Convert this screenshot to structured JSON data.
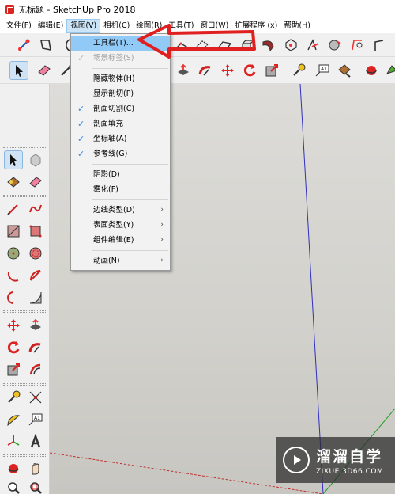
{
  "window": {
    "title": "无标题 - SketchUp Pro 2018"
  },
  "menubar": {
    "items": [
      "文件(F)",
      "编辑(E)",
      "视图(V)",
      "相机(C)",
      "绘图(R)",
      "工具(T)",
      "窗口(W)",
      "扩展程序 (x)",
      "帮助(H)"
    ],
    "active_index": 2
  },
  "view_menu": {
    "items": [
      {
        "label": "工具栏(T)...",
        "checked": false,
        "disabled": false,
        "submenu": false,
        "hover": true
      },
      {
        "label": "场景标签(S)",
        "checked": true,
        "disabled": true,
        "submenu": false
      },
      {
        "sep": true
      },
      {
        "label": "隐藏物体(H)",
        "checked": false,
        "disabled": false,
        "submenu": false
      },
      {
        "label": "显示剖切(P)",
        "checked": false,
        "disabled": false,
        "submenu": false
      },
      {
        "label": "剖面切割(C)",
        "checked": true,
        "disabled": false,
        "submenu": false
      },
      {
        "label": "剖面填充",
        "checked": true,
        "disabled": false,
        "submenu": false
      },
      {
        "label": "坐标轴(A)",
        "checked": true,
        "disabled": false,
        "submenu": false
      },
      {
        "label": "参考线(G)",
        "checked": true,
        "disabled": false,
        "submenu": false
      },
      {
        "sep": true
      },
      {
        "label": "阴影(D)",
        "checked": false,
        "disabled": false,
        "submenu": false
      },
      {
        "label": "雾化(F)",
        "checked": false,
        "disabled": false,
        "submenu": false
      },
      {
        "sep": true
      },
      {
        "label": "边线类型(D)",
        "checked": false,
        "disabled": false,
        "submenu": true
      },
      {
        "label": "表面类型(Y)",
        "checked": false,
        "disabled": false,
        "submenu": true
      },
      {
        "label": "组件编辑(E)",
        "checked": false,
        "disabled": false,
        "submenu": true
      },
      {
        "sep": true
      },
      {
        "label": "动画(N)",
        "checked": false,
        "disabled": false,
        "submenu": true
      }
    ],
    "check_glyph": "✓",
    "submenu_glyph": "›"
  },
  "watermark": {
    "cn": "溜溜自学",
    "url": "ZIXUE.3D66.COM"
  },
  "colors": {
    "accent": "#3c8ee0",
    "annotation_red": "#e02020",
    "axis_blue": "#3030c0",
    "axis_green": "#20a020",
    "axis_red": "#c03030"
  },
  "toolbar_icons": [
    "select-icon",
    "eraser-icon",
    "paint-bucket-icon",
    "push-pull-icon",
    "follow-me-icon",
    "move-icon",
    "rotate-icon",
    "scale-icon",
    "offset-icon",
    "tape-measure-icon",
    "text-icon",
    "paint-icon",
    "orbit-icon"
  ],
  "palette_icons": [
    "select-icon",
    "component-icon",
    "paint-icon",
    "eraser-icon",
    "pencil-icon",
    "freehand-icon",
    "rectangle-icon",
    "rotated-rectangle-icon",
    "circle-icon",
    "polygon-icon",
    "arc-icon",
    "pie-icon",
    "arc-2pt-icon",
    "arc-3pt-icon",
    "move-icon",
    "push-pull-icon",
    "rotate-icon",
    "follow-me-icon",
    "scale-icon",
    "offset-icon",
    "tape-measure-icon",
    "dimension-icon",
    "protractor-icon",
    "text-icon",
    "axes-icon",
    "3d-text-icon",
    "orbit-icon",
    "pan-icon",
    "zoom-icon",
    "zoom-window-icon"
  ]
}
